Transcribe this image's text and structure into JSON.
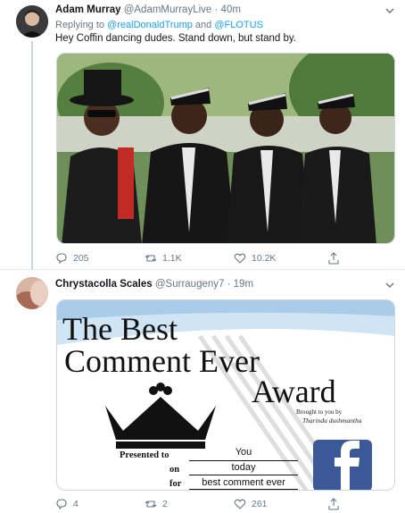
{
  "tweets": [
    {
      "display_name": "Adam Murray",
      "handle": "@AdamMurrayLive",
      "separator": "·",
      "time": "40m",
      "reply_prefix": "Replying to",
      "reply_to_1": "@realDonaldTrump",
      "reply_and": "and",
      "reply_to_2": "@FLOTUS",
      "text": "Hey Coffin dancing dudes. Stand down, but stand by.",
      "media_icon": "coffin-dancers-photo",
      "actions": {
        "replies": "205",
        "retweets": "1.1K",
        "likes": "10.2K"
      }
    },
    {
      "display_name": "Chrystacolla Scales",
      "handle": "@Surraugeny7",
      "separator": "·",
      "time": "19m",
      "media_icon": "best-comment-award-image",
      "award": {
        "line1": "The Best",
        "line2": "Comment Ever",
        "line3": "Award",
        "credit_1": "Brought to you by",
        "credit_2": "Tharindu dushmantha",
        "presented_to_label": "Presented to",
        "presented_to_value": "You",
        "on_label": "on",
        "on_value": "today",
        "for_label": "for",
        "for_value": "best comment ever"
      },
      "actions": {
        "replies": "4",
        "retweets": "2",
        "likes": "261"
      }
    }
  ],
  "colors": {
    "link": "#1da1f2",
    "secondary_text": "#657786",
    "divider": "#e6ecf0",
    "facebook_blue": "#3b5998"
  }
}
